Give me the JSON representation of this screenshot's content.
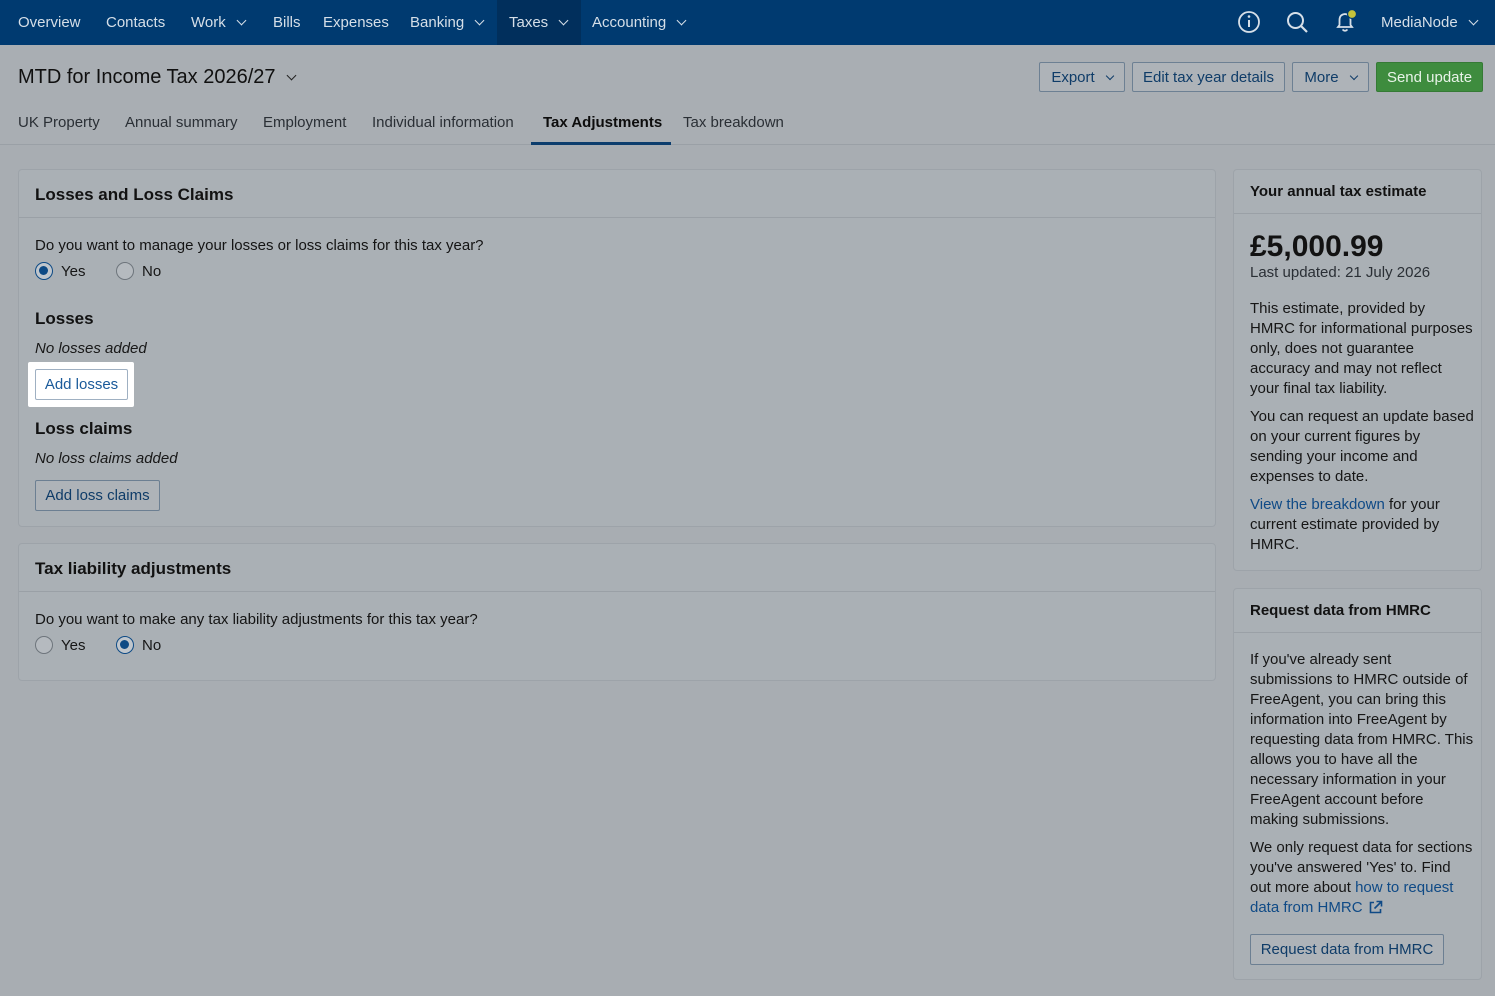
{
  "nav": {
    "items": [
      {
        "label": "Overview"
      },
      {
        "label": "Contacts"
      },
      {
        "label": "Work"
      },
      {
        "label": "Bills"
      },
      {
        "label": "Expenses"
      },
      {
        "label": "Banking"
      },
      {
        "label": "Taxes"
      },
      {
        "label": "Accounting"
      }
    ],
    "account": "MediaNode",
    "icons": [
      "info-icon",
      "search-icon",
      "bell-icon"
    ]
  },
  "header": {
    "title": "MTD for Income Tax 2026/27",
    "export_label": "Export",
    "edit_label": "Edit tax year details",
    "more_label": "More",
    "send_label": "Send update"
  },
  "tabs": [
    {
      "label": "UK Property"
    },
    {
      "label": "Annual summary"
    },
    {
      "label": "Employment"
    },
    {
      "label": "Individual information"
    },
    {
      "label": "Tax Adjustments"
    },
    {
      "label": "Tax breakdown"
    }
  ],
  "losses_card": {
    "title": "Losses and Loss Claims",
    "question": "Do you want to manage your losses or loss claims for this tax year?",
    "yes": "Yes",
    "no": "No",
    "losses_heading": "Losses",
    "losses_empty": "No losses added",
    "add_losses": "Add losses",
    "claims_heading": "Loss claims",
    "claims_empty": "No loss claims added",
    "add_claims": "Add loss claims"
  },
  "liability_card": {
    "title": "Tax liability adjustments",
    "question": "Do you want to make any tax liability adjustments for this tax year?",
    "yes": "Yes",
    "no": "No"
  },
  "estimate_card": {
    "title": "Your annual tax estimate",
    "amount": "£5,000.99",
    "updated": "Last updated: 21 July 2026",
    "p1": "This estimate, provided by HMRC for informational purposes only, does not guarantee accuracy and may not reflect your final tax liability.",
    "p2": "You can request an update based on your current figures by sending your income and expenses to date.",
    "p3_link": "View the breakdown",
    "p3_rest": " for your current estimate provided by HMRC."
  },
  "hmrc_card": {
    "title": "Request data from HMRC",
    "p1": "If you've already sent submissions to HMRC outside of FreeAgent, you can bring this information into FreeAgent by requesting data from HMRC. This allows you to have all the necessary information in your FreeAgent account before making submissions.",
    "p2": "We only request data for sections you've answered 'Yes' to. Find out more about ",
    "p2_link": "how to request data from HMRC",
    "button": "Request data from HMRC"
  }
}
